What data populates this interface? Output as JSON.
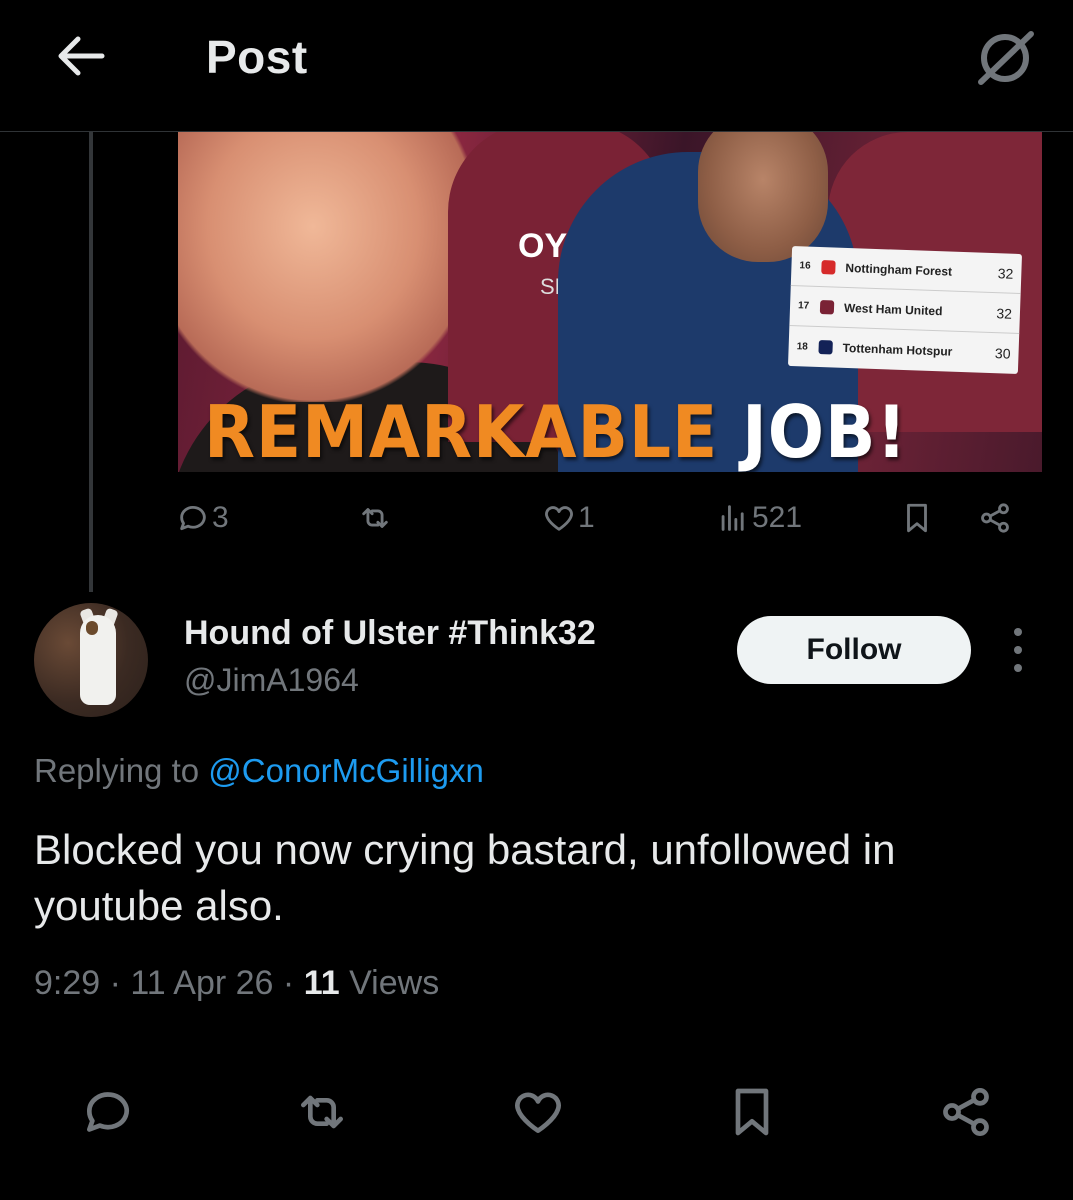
{
  "header": {
    "title": "Post",
    "back_icon": "arrow-left-icon",
    "grok_icon": "grok-icon"
  },
  "media": {
    "headline_word1": "REMARKABLE",
    "headline_word2": "JOB!",
    "league_table": [
      {
        "pos": "16",
        "team": "Nottingham Forest",
        "pts": "32",
        "crest_color": "#d62a2a"
      },
      {
        "pos": "17",
        "team": "West Ham United",
        "pts": "32",
        "crest_color": "#7a2235"
      },
      {
        "pos": "18",
        "team": "Tottenham Hotspur",
        "pts": "30",
        "crest_color": "#132257"
      }
    ],
    "sponsor_text": "OY",
    "sponsor_text2": "SP"
  },
  "quoted_actions": {
    "replies": "3",
    "likes": "1",
    "views": "521"
  },
  "reply": {
    "display_name": "Hound of Ulster #Think32",
    "handle": "@JimA1964",
    "follow_label": "Follow",
    "replying_prefix": "Replying to",
    "replying_to": "@ConorMcGilligxn",
    "text": "Blocked you now crying bastard, unfollowed in youtube also.",
    "time": "9:29",
    "date": "11 Apr 26",
    "views_count": "11",
    "views_label": "Views"
  },
  "colors": {
    "background": "#000000",
    "text_primary": "#e7e9ea",
    "text_secondary": "#71767b",
    "link": "#1d9bf0",
    "headline_orange": "#f08a22"
  }
}
